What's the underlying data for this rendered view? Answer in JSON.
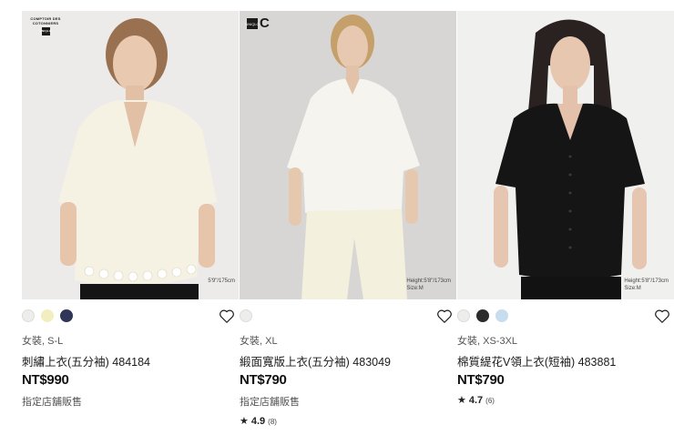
{
  "products": [
    {
      "badge_text": "COMPTOIR DES COTONNIERS",
      "badge_logo": "UNIQLO",
      "model_note": "5'9\"/175cm",
      "swatches": [
        "#ededeb",
        "#f3eebf",
        "#2f3658"
      ],
      "gender_size": "女裝, S-L",
      "name": "刺繡上衣(五分袖) 484184",
      "price": "NT$990",
      "store_note": "指定店舖販售"
    },
    {
      "badge_logo": "UNIQLO",
      "badge_mark": "C",
      "model_note_1": "Height:5'8\"/173cm",
      "model_note_2": "Size:M",
      "swatches": [
        "#ededeb"
      ],
      "gender_size": "女裝, XL",
      "name": "緞面寬版上衣(五分袖) 483049",
      "price": "NT$790",
      "store_note": "指定店舖販售",
      "rating_star": "★",
      "rating": "4.9",
      "review_count": "(8)"
    },
    {
      "model_note_1": "Height:5'8\"/173cm",
      "model_note_2": "Size:M",
      "swatches": [
        "#ededeb",
        "#2b2b2b",
        "#c7dcee"
      ],
      "gender_size": "女裝, XS-3XL",
      "name": "棉質緹花V領上衣(短袖) 483881",
      "price": "NT$790",
      "rating_star": "★",
      "rating": "4.7",
      "review_count": "(6)"
    }
  ],
  "icons": {
    "favorite": "heart-outline-icon",
    "rating": "star-icon"
  },
  "colors": {
    "text": "#1b1b1b",
    "muted": "#555555"
  }
}
